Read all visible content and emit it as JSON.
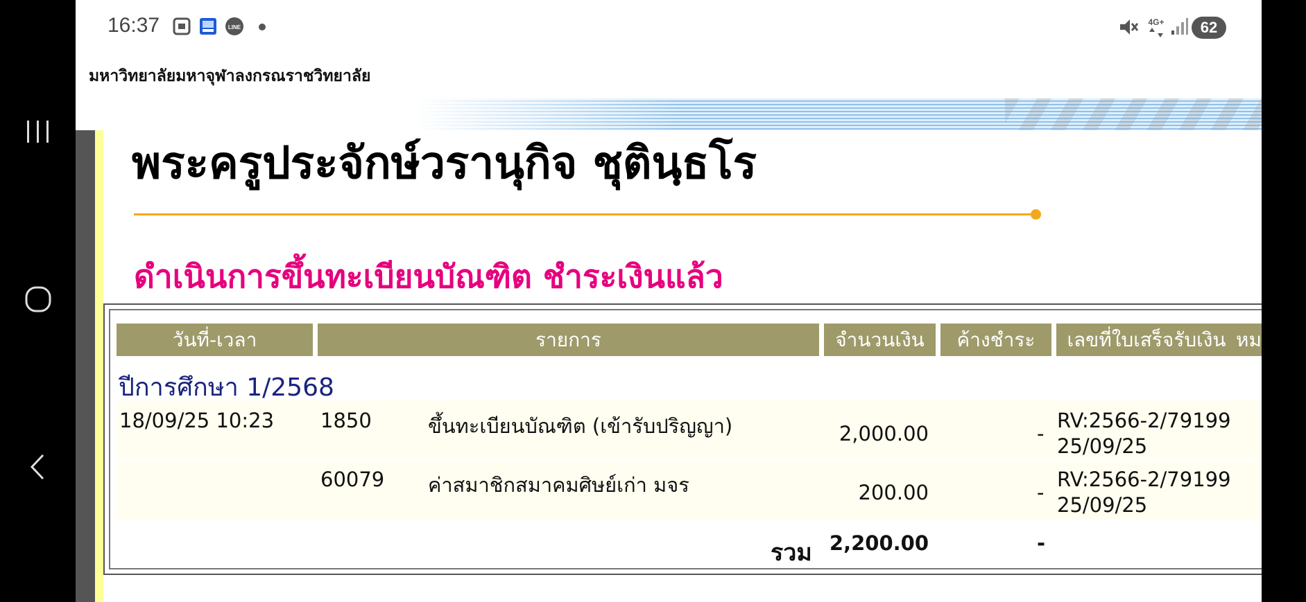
{
  "status_bar": {
    "time": "16:37",
    "battery": "62",
    "network": "4G+"
  },
  "site": {
    "university_name": "มหาวิทยาลัยมหาจุฬาลงกรณราชวิทยาลัย"
  },
  "page": {
    "title": "พระครูประจักษ์วรานุกิจ ชุตินฺธโร",
    "section_title": "ดำเนินการขึ้นทะเบียนบัณฑิต ชำระเงินแล้ว"
  },
  "table": {
    "headers": {
      "datetime": "วันที่-เวลา",
      "item": "รายการ",
      "amount": "จำนวนเงิน",
      "outstanding": "ค้างชำระ",
      "receipt": "เลขที่ใบเสร็จรับเงิน",
      "note": "หม"
    },
    "year_label": "ปีการศึกษา 1/2568",
    "rows": [
      {
        "datetime": "18/09/25 10:23",
        "code": "1850",
        "description": "ขึ้นทะเบียนบัณฑิต (เข้ารับปริญญา)",
        "amount": "2,000.00",
        "outstanding": "-",
        "receipt_no": "RV:2566-2/79199",
        "receipt_date": "25/09/25"
      },
      {
        "datetime": "",
        "code": "60079",
        "description": "ค่าสมาชิกสมาคมศิษย์เก่า มจร",
        "amount": "200.00",
        "outstanding": "-",
        "receipt_no": "RV:2566-2/79199",
        "receipt_date": "25/09/25"
      }
    ],
    "total_label": "รวม",
    "total_amount": "2,200.00",
    "total_outstanding": "-"
  },
  "colors": {
    "header_bg": "#9e9a6a",
    "section_title": "#e6007e",
    "year_label": "#1a237e",
    "rule": "#f3a81b"
  },
  "icons": [
    "screenshot-icon",
    "gallery-icon",
    "line-app-icon",
    "notification-dot-icon",
    "mute-icon",
    "network-4g-icon",
    "signal-icon",
    "recents-icon",
    "home-icon",
    "back-icon"
  ]
}
